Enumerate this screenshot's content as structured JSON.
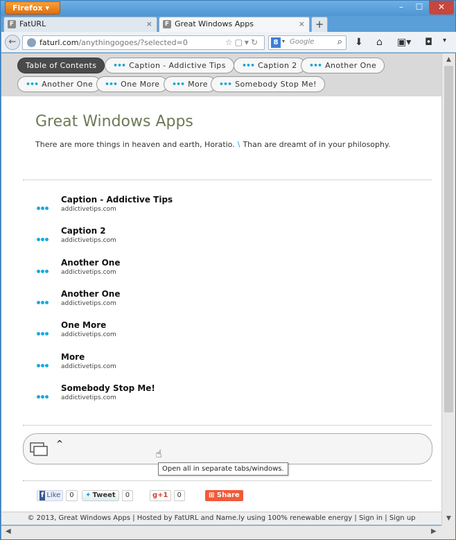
{
  "browser": {
    "menu_label": "Firefox ▾",
    "controls": {
      "minimize": "–",
      "maximize": "☐",
      "close": "✕"
    },
    "tabs": [
      {
        "label": "FatURL",
        "icon": "F",
        "active": false
      },
      {
        "label": "Great Windows Apps",
        "icon": "F",
        "active": true
      }
    ],
    "new_tab": "+",
    "url": {
      "host": "faturl.com",
      "path": "/anythingogoes/?selected=0"
    },
    "search_placeholder": "Google",
    "search_engine_badge": "8",
    "toolbar_icons": [
      "download-icon",
      "home-icon",
      "bookmarks-icon",
      "pocket-icon"
    ]
  },
  "toc": {
    "row1": [
      {
        "label": "Table of Contents",
        "active": true
      },
      {
        "label": "Caption - Addictive Tips",
        "active": false
      },
      {
        "label": "Caption 2",
        "active": false
      },
      {
        "label": "Another One",
        "active": false
      }
    ],
    "row2": [
      {
        "label": "Another One"
      },
      {
        "label": "One More"
      },
      {
        "label": "More"
      },
      {
        "label": "Somebody Stop Me!"
      }
    ],
    "dots": "•••"
  },
  "page": {
    "title": "Great Windows Apps",
    "subtitle_a": "There are more things in heaven and earth, Horatio.",
    "subtitle_sep": "\\",
    "subtitle_b": "Than are dreamt of in your philosophy."
  },
  "items": [
    {
      "caption": "Caption - Addictive Tips",
      "source": "addictivetips.com"
    },
    {
      "caption": "Caption 2",
      "source": "addictivetips.com"
    },
    {
      "caption": "Another One",
      "source": "addictivetips.com"
    },
    {
      "caption": "Another One",
      "source": "addictivetips.com"
    },
    {
      "caption": "One More",
      "source": "addictivetips.com"
    },
    {
      "caption": "More",
      "source": "addictivetips.com"
    },
    {
      "caption": "Somebody Stop Me!",
      "source": "addictivetips.com"
    }
  ],
  "open_all": {
    "caret": "^",
    "tooltip": "Open all in separate tabs/windows."
  },
  "social": {
    "fb_like": "Like",
    "fb_count": "0",
    "tweet": "Tweet",
    "tweet_count": "0",
    "gplus": "+1",
    "gplus_count": "0",
    "share": "Share"
  },
  "footer": {
    "text": "© 2013, Great Windows Apps | Hosted by FatURL and Name.ly using 100% renewable energy |",
    "sign_in": "Sign in",
    "sep": "|",
    "sign_up": "Sign up"
  }
}
